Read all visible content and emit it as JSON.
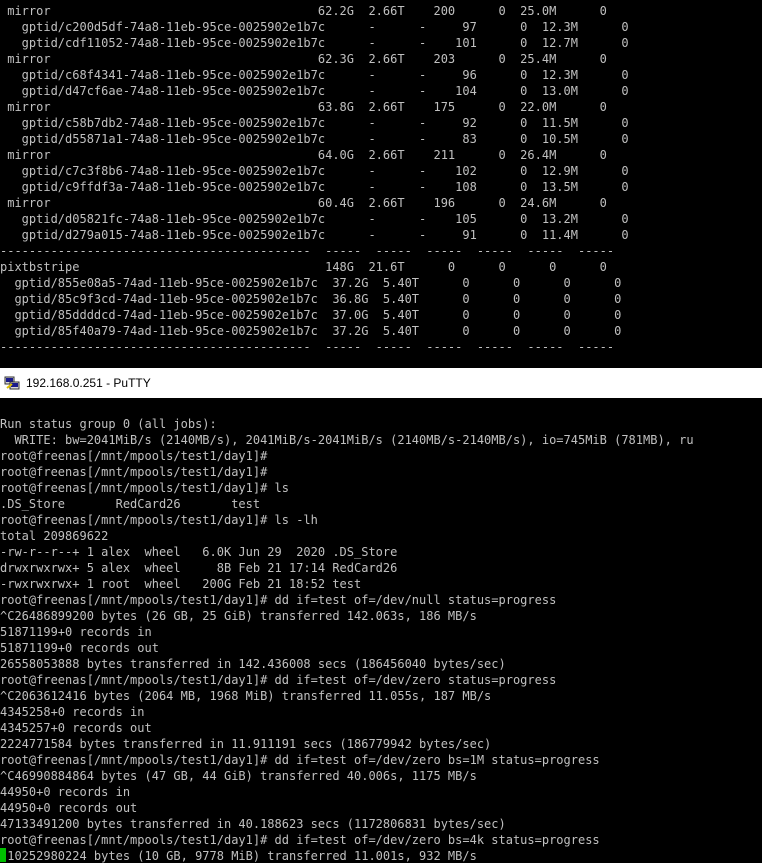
{
  "top_terminal": {
    "lines": [
      " mirror                                     62.2G  2.66T    200      0  25.0M      0",
      "   gptid/c200d5df-74a8-11eb-95ce-0025902e1b7c      -      -     97      0  12.3M      0",
      "   gptid/cdf11052-74a8-11eb-95ce-0025902e1b7c      -      -    101      0  12.7M      0",
      " mirror                                     62.3G  2.66T    203      0  25.4M      0",
      "   gptid/c68f4341-74a8-11eb-95ce-0025902e1b7c      -      -     96      0  12.3M      0",
      "   gptid/d47cf6ae-74a8-11eb-95ce-0025902e1b7c      -      -    104      0  13.0M      0",
      " mirror                                     63.8G  2.66T    175      0  22.0M      0",
      "   gptid/c58b7db2-74a8-11eb-95ce-0025902e1b7c      -      -     92      0  11.5M      0",
      "   gptid/d55871a1-74a8-11eb-95ce-0025902e1b7c      -      -     83      0  10.5M      0",
      " mirror                                     64.0G  2.66T    211      0  26.4M      0",
      "   gptid/c7c3f8b6-74a8-11eb-95ce-0025902e1b7c      -      -    102      0  12.9M      0",
      "   gptid/c9ffdf3a-74a8-11eb-95ce-0025902e1b7c      -      -    108      0  13.5M      0",
      " mirror                                     60.4G  2.66T    196      0  24.6M      0",
      "   gptid/d05821fc-74a8-11eb-95ce-0025902e1b7c      -      -    105      0  13.2M      0",
      "   gptid/d279a015-74a8-11eb-95ce-0025902e1b7c      -      -     91      0  11.4M      0",
      "-------------------------------------------  -----  -----  -----  -----  -----  -----",
      "pixtbstripe                                  148G  21.6T      0      0      0      0",
      "  gptid/855e08a5-74ad-11eb-95ce-0025902e1b7c  37.2G  5.40T      0      0      0      0",
      "  gptid/85c9f3cd-74ad-11eb-95ce-0025902e1b7c  36.8G  5.40T      0      0      0      0",
      "  gptid/85ddddcd-74ad-11eb-95ce-0025902e1b7c  37.0G  5.40T      0      0      0      0",
      "  gptid/85f40a79-74ad-11eb-95ce-0025902e1b7c  37.2G  5.40T      0      0      0      0",
      "-------------------------------------------  -----  -----  -----  -----  -----  -----"
    ]
  },
  "window": {
    "title": "192.168.0.251 - PuTTY",
    "icon": "putty-icon"
  },
  "bottom_terminal": {
    "lines": [
      "Run status group 0 (all jobs):",
      "  WRITE: bw=2041MiB/s (2140MB/s), 2041MiB/s-2041MiB/s (2140MB/s-2140MB/s), io=745MiB (781MB), ru",
      "root@freenas[/mnt/mpools/test1/day1]#",
      "root@freenas[/mnt/mpools/test1/day1]#",
      "root@freenas[/mnt/mpools/test1/day1]# ls",
      ".DS_Store       RedCard26       test",
      "root@freenas[/mnt/mpools/test1/day1]# ls -lh",
      "total 209869622",
      "-rw-r--r--+ 1 alex  wheel   6.0K Jun 29  2020 .DS_Store",
      "drwxrwxrwx+ 5 alex  wheel     8B Feb 21 17:14 RedCard26",
      "-rwxrwxrwx+ 1 root  wheel   200G Feb 21 18:52 test",
      "root@freenas[/mnt/mpools/test1/day1]# dd if=test of=/dev/null status=progress",
      "^C26486899200 bytes (26 GB, 25 GiB) transferred 142.063s, 186 MB/s",
      "51871199+0 records in",
      "51871199+0 records out",
      "26558053888 bytes transferred in 142.436008 secs (186456040 bytes/sec)",
      "root@freenas[/mnt/mpools/test1/day1]# dd if=test of=/dev/zero status=progress",
      "^C2063612416 bytes (2064 MB, 1968 MiB) transferred 11.055s, 187 MB/s",
      "4345258+0 records in",
      "4345257+0 records out",
      "2224771584 bytes transferred in 11.911191 secs (186779942 bytes/sec)",
      "root@freenas[/mnt/mpools/test1/day1]# dd if=test of=/dev/zero bs=1M status=progress",
      "^C46990884864 bytes (47 GB, 44 GiB) transferred 40.006s, 1175 MB/s",
      "44950+0 records in",
      "44950+0 records out",
      "47133491200 bytes transferred in 40.188623 secs (1172806831 bytes/sec)",
      "root@freenas[/mnt/mpools/test1/day1]# dd if=test of=/dev/zero bs=4k status=progress",
      " 10252980224 bytes (10 GB, 9778 MiB) transferred 11.001s, 932 MB/s"
    ]
  },
  "colors": {
    "terminal_bg": "#000000",
    "terminal_fg": "#c0c0c0",
    "cursor": "#00c000",
    "titlebar_bg": "#ffffff"
  }
}
